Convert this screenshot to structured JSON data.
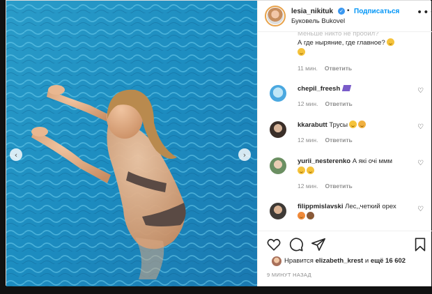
{
  "header": {
    "username": "lesia_nikituk",
    "verified_glyph": "✓",
    "separator": "•",
    "follow_label": "Подписаться",
    "location": "Буковель Bukovel",
    "more_glyph": "•••"
  },
  "photo": {
    "prev_glyph": "‹",
    "next_glyph": "›"
  },
  "comments": {
    "cut_line": "Меньше никто не пробил?",
    "first": {
      "text_line1": "А где ныряние, где главное?",
      "time": "11 мин.",
      "reply": "Ответить"
    },
    "items": [
      {
        "username": "chepil_freesh",
        "text": "",
        "time": "12 мин.",
        "reply": "Ответить",
        "avatar_color": "#4aa8e0",
        "emoji": "badge"
      },
      {
        "username": "kkarabutt",
        "text": "Трусы",
        "time": "12 мин.",
        "reply": "Ответить",
        "avatar_color": "#5a4a40",
        "emoji": "two"
      },
      {
        "username": "yurii_nesterenko",
        "text": "А які очі ммм",
        "time": "12 мин.",
        "reply": "Ответить",
        "avatar_color": "#6b8f62",
        "emoji": "twobelow"
      },
      {
        "username": "filippmislavski",
        "text": "Лес,,четкий орех",
        "time": "",
        "reply": "",
        "avatar_color": "#3e3a36",
        "emoji": "twobelow"
      }
    ],
    "heart_glyph": "♡"
  },
  "actions": {
    "like_icon": "heart-outline-icon",
    "comment_icon": "comment-bubble-icon",
    "share_icon": "paper-plane-icon",
    "save_icon": "bookmark-icon",
    "liked_by_prefix": "Нравится",
    "liked_by_user": "elizabeth_krest",
    "liked_by_and": "и",
    "liked_by_count": "ещё 16 602",
    "posted_ago": "9 МИНУТ НАЗАД"
  },
  "colors": {
    "accent": "#0095f6",
    "pool": "#1e8ab8",
    "text": "#262626",
    "muted": "#8e8e8e"
  }
}
